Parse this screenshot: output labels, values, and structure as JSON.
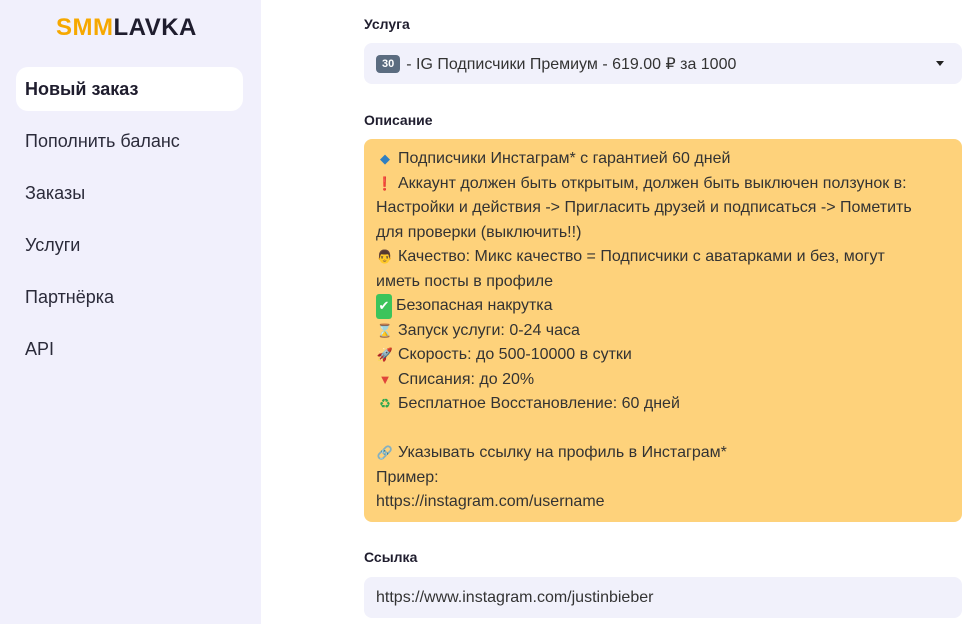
{
  "logo": {
    "part1": "SMM",
    "part2": "LAVKA"
  },
  "nav": [
    "Новый заказ",
    "Пополнить баланс",
    "Заказы",
    "Услуги",
    "Партнёрка",
    "API"
  ],
  "service": {
    "label": "Услуга",
    "badge": "30",
    "value": "- IG Подписчики Премиум - 619.00 ₽ за 1000"
  },
  "description": {
    "label": "Описание",
    "lines": [
      {
        "icon": "◆",
        "text": "Подписчики Инстаграм* с гарантией 60 дней"
      },
      {
        "icon": "❗",
        "text": "Аккаунт должен быть открытым, должен быть выключен ползунок в:"
      },
      {
        "icon": "",
        "text": "Настройки и действия -> Пригласить друзей и подписаться -> Пометить"
      },
      {
        "icon": "",
        "text": "для проверки (выключить!!)"
      },
      {
        "icon": "👨",
        "text": "Качество: Микс качество = Подписчики с аватарками и без, могут"
      },
      {
        "icon": "",
        "text": "иметь посты в профиле"
      },
      {
        "icon": "✔",
        "text": "Безопасная накрутка"
      },
      {
        "icon": "⌛",
        "text": "Запуск услуги: 0-24 часа"
      },
      {
        "icon": "🚀",
        "text": "Скорость: до 500-10000 в сутки"
      },
      {
        "icon": "▼",
        "text": "Списания: до 20%"
      },
      {
        "icon": "♻",
        "text": "Бесплатное Восстановление: 60 дней"
      },
      {
        "icon": "",
        "text": ""
      },
      {
        "icon": "🔗",
        "text": "Указывать ссылку на профиль в Инстаграм*"
      },
      {
        "icon": "",
        "text": "Пример:"
      },
      {
        "icon": "",
        "text": "https://instagram.com/username"
      }
    ]
  },
  "link": {
    "label": "Ссылка",
    "value": "https://www.instagram.com/justinbieber"
  }
}
